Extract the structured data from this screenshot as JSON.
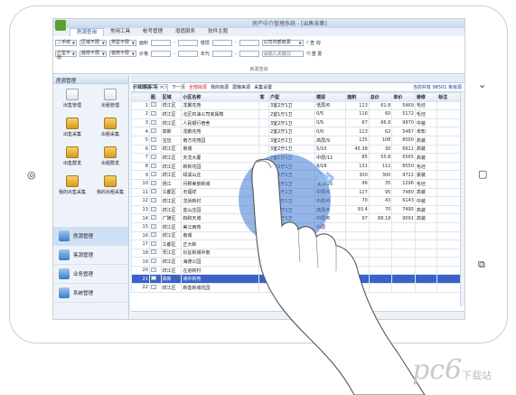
{
  "titlebar": {
    "title": "房产中介管理系统 - [出售采集]"
  },
  "menu": {
    "items": [
      "房源查询",
      "常用工具",
      "帐号管理",
      "增值服务",
      "软件主题"
    ],
    "active_index": 0
  },
  "ribbon": {
    "row1": {
      "combos": [
        "二手房",
        "区域不限",
        "类型不限"
      ],
      "labels": [
        "面积",
        "楼层"
      ],
      "dash": "-",
      "source_combo": "公司内部房源",
      "search_btn": "查 询"
    },
    "row2": {
      "combos": [
        "户型不限",
        "装修不限",
        "装修不限"
      ],
      "labels": [
        "价格",
        "年代"
      ],
      "dash": "-",
      "keyword_placeholder": "请输入关键词",
      "reset_btn": "重 置"
    },
    "group_label": "房源查询"
  },
  "leftnav": {
    "header": "房源管理",
    "grid": [
      "出售管理",
      "出租管理",
      "出售采集",
      "出租采集",
      "出售群发",
      "出租群发",
      "我的出售采集",
      "我的出租采集"
    ],
    "main": [
      "房源管理",
      "客源管理",
      "业务管理",
      "系统管理"
    ],
    "main_active_index": 0
  },
  "main": {
    "tab_label": "出售采集 ×",
    "toolbar": [
      "刷新数据",
      "上一页",
      "下一页",
      "全部房源",
      "我的房源",
      "屏蔽来源",
      "采集设置"
    ],
    "toolbar_right": "当前共有 98501 条房源",
    "columns": [
      "",
      "图",
      "区域",
      "小区名称",
      "客",
      "户型",
      "楼层",
      "面积",
      "总价",
      "单价",
      "装修",
      "标注"
    ],
    "rows": [
      [
        "1",
        "",
        "祥江区",
        "龙翼花苑",
        "",
        "3室2厅1卫",
        "低层/6",
        "113",
        "61.8",
        "5469",
        "毛坯",
        ""
      ],
      [
        "2",
        "",
        "祥江区",
        "北区石油公司家属楼",
        "",
        "2室1厅1卫",
        "0/5",
        "116",
        "60",
        "5172",
        "毛坯",
        ""
      ],
      [
        "3",
        "",
        "祥江区",
        "人民银行宿舍",
        "",
        "3室2厅1卫",
        "0/5",
        "67",
        "66.8",
        "9970",
        "中装",
        ""
      ],
      [
        "4",
        "",
        "高新",
        "龙鹏花苑",
        "",
        "2室2厅1卫",
        "0/0",
        "113",
        "62",
        "5487",
        "未知",
        ""
      ],
      [
        "5",
        "",
        "宝应",
        "南方花苑园",
        "",
        "3室2厅2卫",
        "高层/9",
        "135",
        "108",
        "8000",
        "高装",
        ""
      ],
      [
        "6",
        "",
        "祥江区",
        "南城",
        "",
        "3室2厅1卫",
        "5/10",
        "45.38",
        "30",
        "6611",
        "高装",
        ""
      ],
      [
        "7",
        "",
        "祥江区",
        "天龙大厦",
        "",
        "2室1厅1卫",
        "中层/11",
        "85",
        "55.8",
        "6565",
        "高装",
        ""
      ],
      [
        "8",
        "",
        "祥江区",
        "新新花园",
        "",
        "2室2厅1卫",
        "9/18",
        "131",
        "112",
        "8550",
        "毛坯",
        ""
      ],
      [
        "9",
        "",
        "祥江区",
        "绿溪山庄",
        "",
        "2室2厅1卫",
        "0/3",
        "300",
        "300",
        "9722",
        "豪装",
        ""
      ],
      [
        "10",
        "",
        "扬江",
        "月穆美景新城",
        "",
        "2室2厅1卫",
        "低层/25",
        "96",
        "35",
        "1296",
        "毛坯",
        ""
      ],
      [
        "11",
        "",
        "江都区",
        "天福祥",
        "",
        "3室1厅1卫",
        "中层/6",
        "127",
        "95",
        "7480",
        "高装",
        ""
      ],
      [
        "12",
        "",
        "祥江区",
        "龙骄新村",
        "",
        "3室2厅1卫",
        "中层/6",
        "70",
        "43",
        "6143",
        "中装",
        ""
      ],
      [
        "13",
        "",
        "祥江区",
        "蓝山庄园",
        "",
        "3室2厅1卫",
        "高层/6",
        "93.4",
        "70",
        "7495",
        "高装",
        ""
      ],
      [
        "14",
        "",
        "广陵区",
        "皖和天城",
        "",
        "3室2厅1卫",
        "中层/6",
        "97",
        "88.18",
        "9091",
        "高装",
        ""
      ],
      [
        "15",
        "",
        "祥江区",
        "美江西苑",
        "",
        "3室2厅1卫",
        "中层",
        "",
        "",
        "",
        "",
        ""
      ],
      [
        "16",
        "",
        "祥江区",
        "南城",
        "",
        "2室",
        "",
        "",
        "",
        "",
        "",
        ""
      ],
      [
        "17",
        "",
        "江都区",
        "正大新",
        "",
        "",
        "",
        "",
        "",
        "",
        "",
        ""
      ],
      [
        "18",
        "",
        "邗江区",
        "仪征新城中南",
        "",
        "",
        "",
        "",
        "",
        "",
        "",
        ""
      ],
      [
        "19",
        "",
        "祥江区",
        "海德公园",
        "",
        "",
        "",
        "",
        "",
        "",
        "",
        ""
      ],
      [
        "20",
        "",
        "祥江区",
        "左道新村",
        "",
        "",
        "",
        "",
        "",
        "",
        "",
        ""
      ],
      [
        "21",
        "",
        "高新",
        "城中新苑",
        "",
        "",
        "",
        "",
        "",
        "",
        "",
        ""
      ],
      [
        "22",
        "",
        "祥江区",
        "新善新城花园",
        "",
        "",
        "",
        "",
        "",
        "",
        "",
        ""
      ]
    ],
    "selected_row_index": 20
  },
  "watermark": {
    "logo": "pc6",
    "sub": "下载站"
  },
  "colors": {
    "selected_row": "#3a63c9",
    "overlay": "#3c78d2"
  }
}
